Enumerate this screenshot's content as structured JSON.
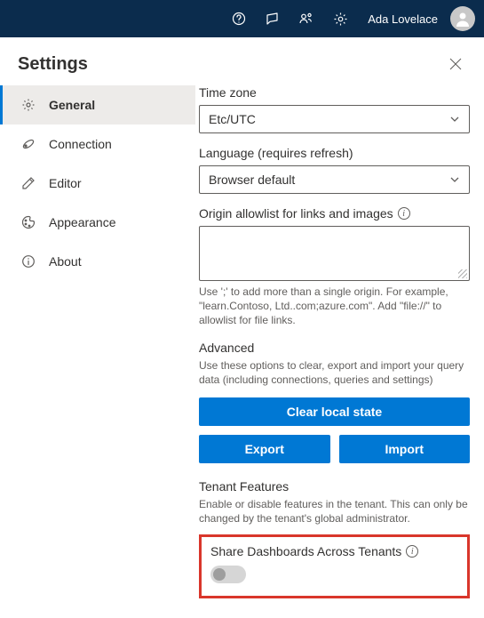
{
  "topbar": {
    "user_name": "Ada Lovelace"
  },
  "panel": {
    "title": "Settings"
  },
  "sidebar": {
    "items": [
      {
        "label": "General",
        "selected": true
      },
      {
        "label": "Connection",
        "selected": false
      },
      {
        "label": "Editor",
        "selected": false
      },
      {
        "label": "Appearance",
        "selected": false
      },
      {
        "label": "About",
        "selected": false
      }
    ]
  },
  "general": {
    "timezone": {
      "label": "Time zone",
      "value": "Etc/UTC"
    },
    "language": {
      "label": "Language (requires refresh)",
      "value": "Browser default"
    },
    "origin": {
      "label": "Origin allowlist for links and images",
      "value": "",
      "hint": "Use ';' to add more than a single origin. For example, \"learn.Contoso, Ltd..com;azure.com\". Add \"file://\" to allowlist for file links."
    },
    "advanced": {
      "title": "Advanced",
      "desc": "Use these options to clear, export and import your query data (including connections, queries and settings)",
      "clear_btn": "Clear local state",
      "export_btn": "Export",
      "import_btn": "Import"
    },
    "tenant": {
      "title": "Tenant Features",
      "desc": "Enable or disable features in the tenant. This can only be changed by the tenant's global administrator.",
      "share_label": "Share Dashboards Across Tenants",
      "share_value": false
    }
  }
}
